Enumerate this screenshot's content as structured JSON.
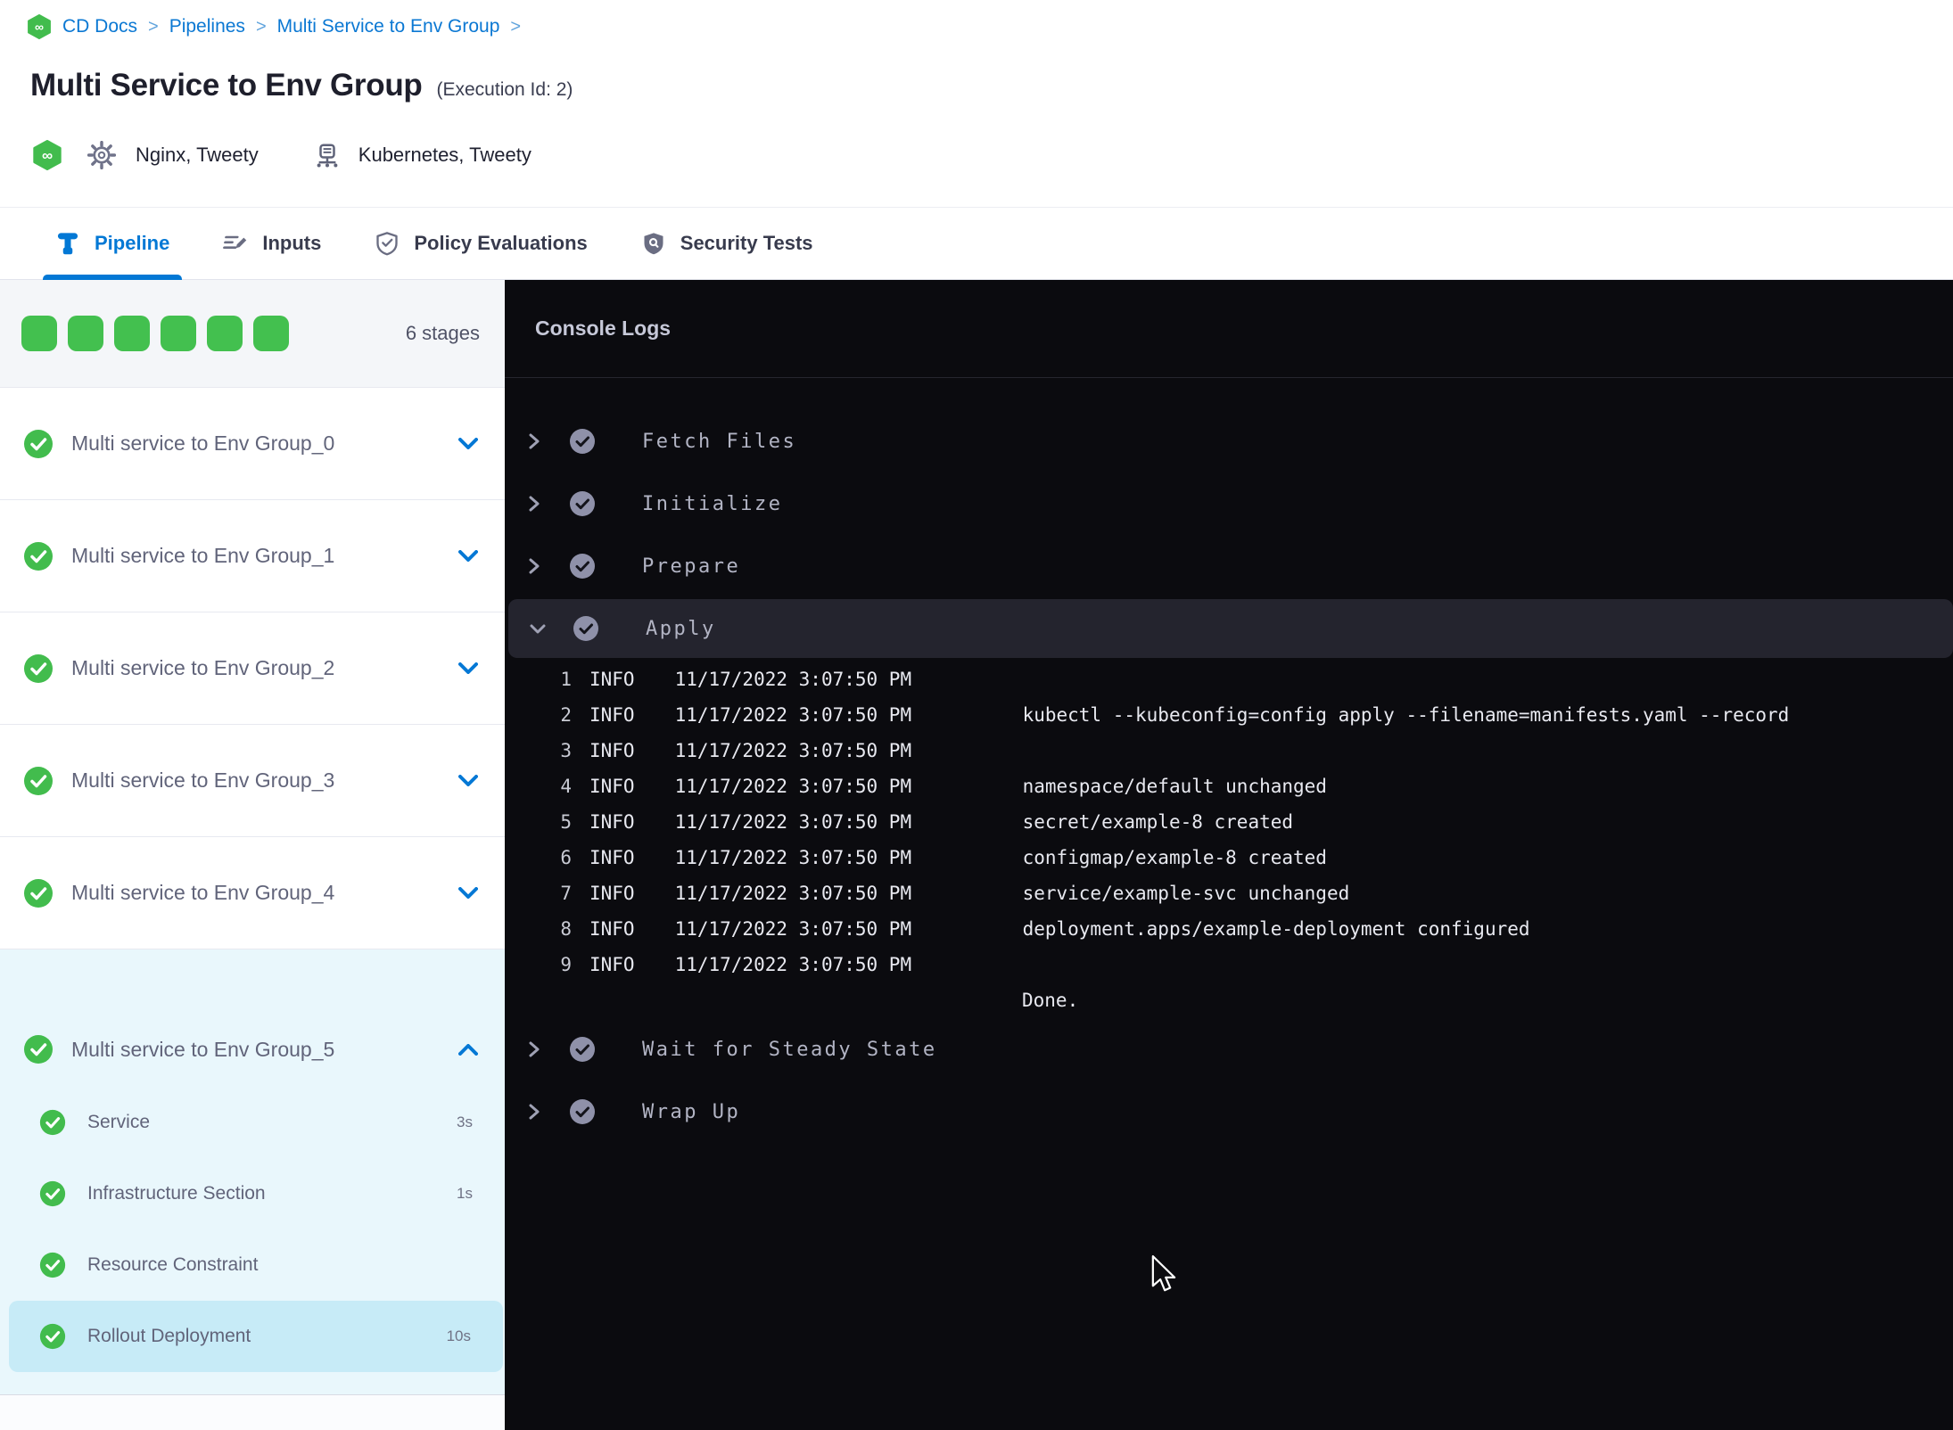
{
  "breadcrumb": {
    "items": [
      "CD Docs",
      "Pipelines",
      "Multi Service to Env Group"
    ],
    "separator": ">"
  },
  "header": {
    "title": "Multi Service to Env Group",
    "execution_id": "(Execution Id: 2)",
    "services": "Nginx, Tweety",
    "environments": "Kubernetes, Tweety"
  },
  "tabs": [
    {
      "label": "Pipeline",
      "active": true
    },
    {
      "label": "Inputs",
      "active": false
    },
    {
      "label": "Policy Evaluations",
      "active": false
    },
    {
      "label": "Security Tests",
      "active": false
    }
  ],
  "sidebar": {
    "stages_count": "6 stages",
    "stage_squares": 6,
    "stages": [
      {
        "label": "Multi service to Env Group_0",
        "status": "success",
        "expanded": false
      },
      {
        "label": "Multi service to Env Group_1",
        "status": "success",
        "expanded": false
      },
      {
        "label": "Multi service to Env Group_2",
        "status": "success",
        "expanded": false
      },
      {
        "label": "Multi service to Env Group_3",
        "status": "success",
        "expanded": false
      },
      {
        "label": "Multi service to Env Group_4",
        "status": "success",
        "expanded": false
      },
      {
        "label": "Multi service to Env Group_5",
        "status": "success",
        "expanded": true,
        "steps": [
          {
            "label": "Service",
            "duration": "3s",
            "status": "success",
            "selected": false
          },
          {
            "label": "Infrastructure Section",
            "duration": "1s",
            "status": "success",
            "selected": false
          },
          {
            "label": "Resource Constraint",
            "duration": "",
            "status": "success",
            "selected": false
          },
          {
            "label": "Rollout Deployment",
            "duration": "10s",
            "status": "success",
            "selected": true
          }
        ]
      }
    ]
  },
  "console": {
    "title": "Console Logs",
    "steps_before": [
      "Fetch Files",
      "Initialize",
      "Prepare"
    ],
    "expanded_step": "Apply",
    "steps_after": [
      "Wait for Steady State",
      "Wrap Up"
    ],
    "logs": [
      {
        "num": "1",
        "level": "INFO",
        "time": "11/17/2022 3:07:50 PM",
        "message": ""
      },
      {
        "num": "2",
        "level": "INFO",
        "time": "11/17/2022 3:07:50 PM",
        "message": "kubectl --kubeconfig=config apply --filename=manifests.yaml --record"
      },
      {
        "num": "3",
        "level": "INFO",
        "time": "11/17/2022 3:07:50 PM",
        "message": ""
      },
      {
        "num": "4",
        "level": "INFO",
        "time": "11/17/2022 3:07:50 PM",
        "message": "namespace/default unchanged"
      },
      {
        "num": "5",
        "level": "INFO",
        "time": "11/17/2022 3:07:50 PM",
        "message": "secret/example-8 created"
      },
      {
        "num": "6",
        "level": "INFO",
        "time": "11/17/2022 3:07:50 PM",
        "message": "configmap/example-8 created"
      },
      {
        "num": "7",
        "level": "INFO",
        "time": "11/17/2022 3:07:50 PM",
        "message": "service/example-svc unchanged"
      },
      {
        "num": "8",
        "level": "INFO",
        "time": "11/17/2022 3:07:50 PM",
        "message": "deployment.apps/example-deployment configured"
      },
      {
        "num": "9",
        "level": "INFO",
        "time": "11/17/2022 3:07:50 PM",
        "message": ""
      }
    ],
    "done": "Done."
  },
  "colors": {
    "accent_blue": "#0278d5",
    "success_green": "#42bc4d",
    "console_bg": "#0b0b0f",
    "expanded_stage_bg": "#e9f7fc",
    "selected_step_bg": "#c7ebf7"
  }
}
